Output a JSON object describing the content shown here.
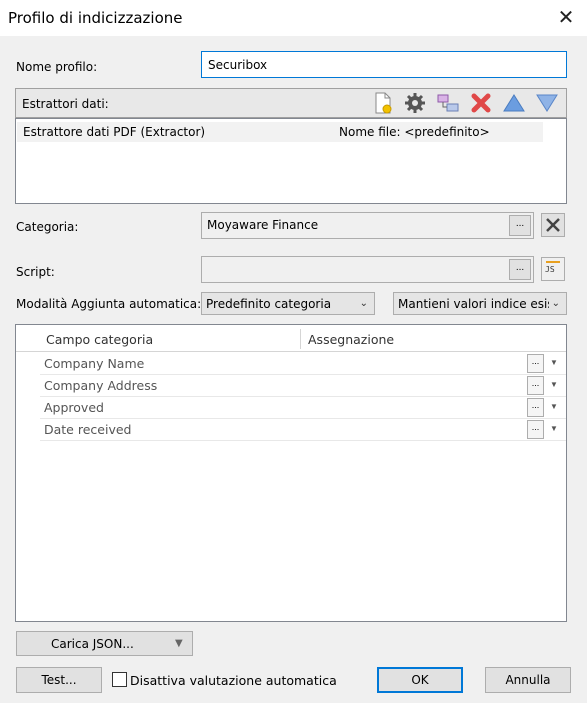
{
  "window": {
    "title": "Profilo di indicizzazione",
    "close_glyph": "✕"
  },
  "profile_name": {
    "label": "Nome profilo:",
    "value": "Securibox"
  },
  "extractors": {
    "label": "Estrattori dati:",
    "toolbar_icons": [
      "new-document-icon",
      "gear-icon",
      "link-icon",
      "delete-icon",
      "move-up-icon",
      "move-down-icon"
    ],
    "items": [
      {
        "name": "Estrattore dati PDF (Extractor)",
        "file": "Nome file: <predefinito>"
      }
    ]
  },
  "category": {
    "label": "Categoria:",
    "value": "Moyaware Finance",
    "browse": "...",
    "clear_glyph": "✕"
  },
  "script": {
    "label": "Script:",
    "value": "",
    "browse": "...",
    "js_label": "JS"
  },
  "auto_add": {
    "label": "Modalità Aggiunta automatica:",
    "mode_value": "Predefinito categoria",
    "keep_value": "Mantieni valori indice esis"
  },
  "grid": {
    "columns": [
      "Campo categoria",
      "Assegnazione"
    ],
    "rows": [
      {
        "field": "Company Name",
        "assignment": "",
        "browse": "..."
      },
      {
        "field": "Company Address",
        "assignment": "",
        "browse": "..."
      },
      {
        "field": "Approved",
        "assignment": "",
        "browse": "..."
      },
      {
        "field": "Date received",
        "assignment": "",
        "browse": "..."
      }
    ]
  },
  "footer": {
    "load_json": "Carica JSON...",
    "test": "Test...",
    "disable_auto_eval": "Disattiva valutazione automatica",
    "ok": "OK",
    "cancel": "Annulla"
  }
}
